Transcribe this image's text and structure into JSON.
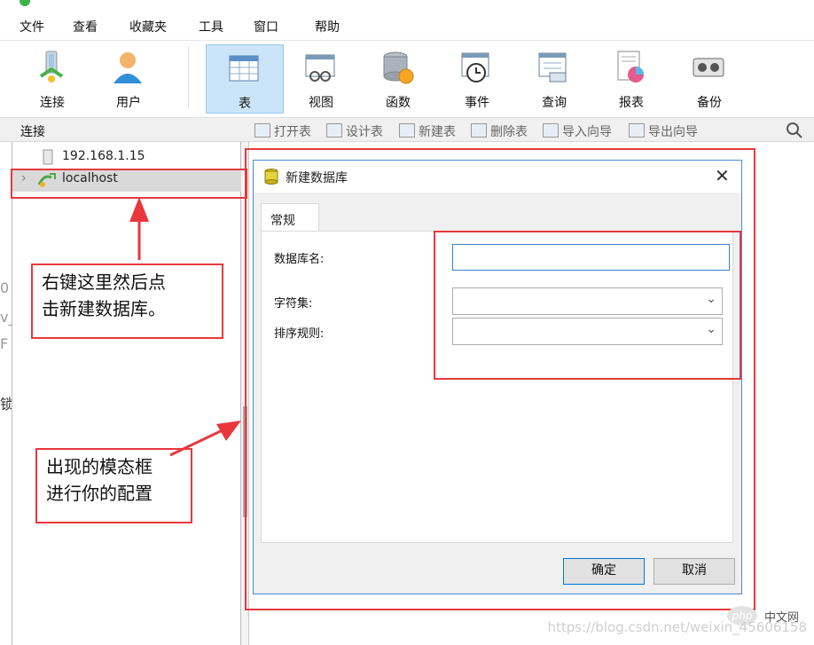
{
  "menubar": {
    "items": [
      "文件",
      "查看",
      "收藏夹",
      "工具",
      "窗口",
      "帮助"
    ]
  },
  "toolbar": {
    "items": [
      {
        "label": "连接",
        "icon": "connection-icon"
      },
      {
        "label": "用户",
        "icon": "user-icon"
      },
      {
        "label": "表",
        "icon": "table-icon",
        "active": true
      },
      {
        "label": "视图",
        "icon": "view-icon"
      },
      {
        "label": "函数",
        "icon": "function-icon"
      },
      {
        "label": "事件",
        "icon": "event-icon"
      },
      {
        "label": "查询",
        "icon": "query-icon"
      },
      {
        "label": "报表",
        "icon": "report-icon"
      },
      {
        "label": "备份",
        "icon": "backup-icon"
      }
    ]
  },
  "subbar": {
    "left_label": "连接",
    "items": [
      "打开表",
      "设计表",
      "新建表",
      "删除表",
      "导入向导",
      "导出向导"
    ]
  },
  "tree": {
    "items": [
      {
        "label": "192.168.1.15",
        "icon": "server-icon"
      },
      {
        "label": "localhost",
        "icon": "mysql-connection-icon"
      }
    ]
  },
  "dialog": {
    "title": "新建数据库",
    "tab": "常规",
    "fields": {
      "db_name_label": "数据库名:",
      "db_name_value": "",
      "charset_label": "字符集:",
      "charset_value": "",
      "collation_label": "排序规则:",
      "collation_value": ""
    },
    "ok": "确定",
    "cancel": "取消"
  },
  "annotations": {
    "note1_line1": "右键这里然后点",
    "note1_line2": "击新建数据库。",
    "note2_line1": "出现的模态框",
    "note2_line2": "进行你的配置"
  },
  "edge_fragments": [
    "0",
    "v_",
    "F",
    "锁"
  ],
  "watermark": {
    "url": "https://blog.csdn.net/weixin_45606158",
    "logo": "php",
    "logo_text": "中文网"
  },
  "colors": {
    "annotation_red": "#e8383d",
    "dialog_border": "#4a8ad6",
    "active_tool": "#cce4f7"
  }
}
